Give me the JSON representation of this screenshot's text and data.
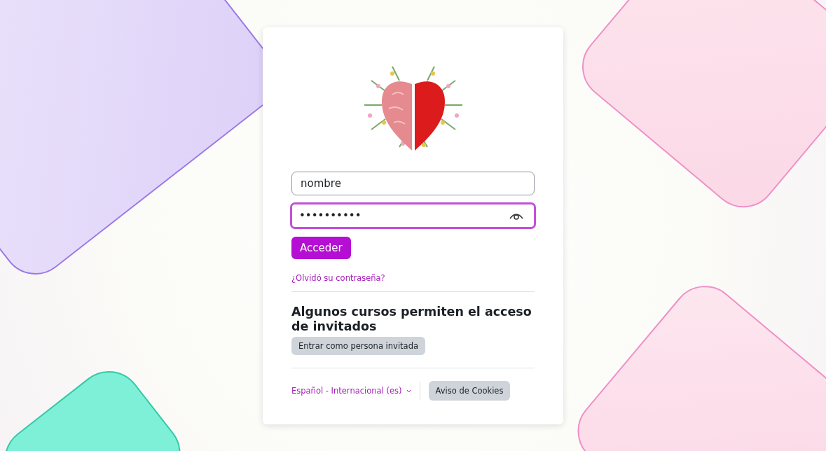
{
  "login": {
    "username": {
      "value": "nombre",
      "focused": false
    },
    "password": {
      "value": "••••••••••",
      "focused": true
    },
    "submit": "Acceder",
    "forgot_link": "¿Olvidó su contraseña?"
  },
  "guest": {
    "heading": "Algunos cursos permiten el acceso de invitados",
    "button": "Entrar como persona invitada"
  },
  "footer": {
    "language": "Español - Internacional (es)",
    "cookies_button": "Aviso de Cookies"
  }
}
